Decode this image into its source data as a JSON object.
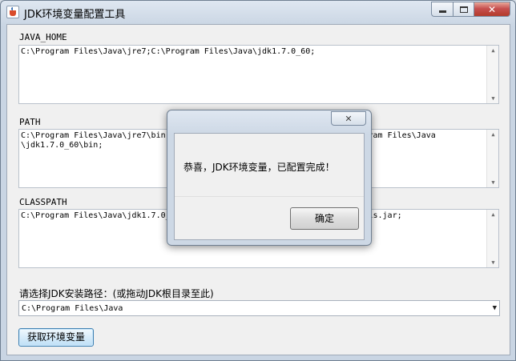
{
  "window": {
    "title": "JDK环境变量配置工具",
    "controls": {
      "minimize": "—",
      "maximize": "□",
      "close": "✕"
    }
  },
  "java_home": {
    "label": "JAVA_HOME",
    "value": "C:\\Program Files\\Java\\jre7;C:\\Program Files\\Java\\jdk1.7.0_60;"
  },
  "path": {
    "label": "PATH",
    "value": "C:\\Program Files\\Java\\jre7\\bin;                                  C:\\Program Files\\Java\n\\jdk1.7.0_60\\bin;"
  },
  "classpath": {
    "label": "CLASSPATH",
    "value": "C:\\Program Files\\Java\\jdk1.7.0_                                   ib\\tools.jar;"
  },
  "install_path": {
    "label": "请选择JDK安装路径：(或拖动JDK根目录至此)",
    "value": "C:\\Program Files\\Java"
  },
  "get_button": {
    "label": "获取环境变量"
  },
  "dialog": {
    "close": "✕",
    "message": "恭喜，JDK环境变量，已配置完成！",
    "ok_label": "确定"
  },
  "colors": {
    "accent": "#3c7fb1",
    "close_red": "#c75050"
  }
}
